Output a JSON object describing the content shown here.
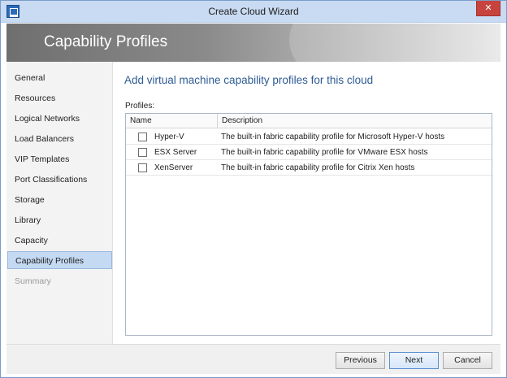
{
  "window": {
    "title": "Create Cloud Wizard",
    "close_glyph": "✕",
    "icon": "wizard-app-icon"
  },
  "banner": {
    "title": "Capability Profiles"
  },
  "sidebar": {
    "items": [
      {
        "label": "General",
        "state": "normal"
      },
      {
        "label": "Resources",
        "state": "normal"
      },
      {
        "label": "Logical Networks",
        "state": "normal"
      },
      {
        "label": "Load Balancers",
        "state": "normal"
      },
      {
        "label": "VIP Templates",
        "state": "normal"
      },
      {
        "label": "Port Classifications",
        "state": "normal"
      },
      {
        "label": "Storage",
        "state": "normal"
      },
      {
        "label": "Library",
        "state": "normal"
      },
      {
        "label": "Capacity",
        "state": "normal"
      },
      {
        "label": "Capability Profiles",
        "state": "selected"
      },
      {
        "label": "Summary",
        "state": "disabled"
      }
    ]
  },
  "main": {
    "heading": "Add virtual machine capability profiles for this cloud",
    "profiles_label": "Profiles:",
    "columns": [
      "Name",
      "Description"
    ],
    "rows": [
      {
        "name": "Hyper-V",
        "description": "The built-in fabric capability profile for Microsoft Hyper-V hosts",
        "checked": false
      },
      {
        "name": "ESX Server",
        "description": "The built-in fabric capability profile for VMware ESX hosts",
        "checked": false
      },
      {
        "name": "XenServer",
        "description": "The built-in fabric capability profile for Citrix Xen hosts",
        "checked": false
      }
    ]
  },
  "footer": {
    "previous_label": "Previous",
    "next_label": "Next",
    "cancel_label": "Cancel"
  },
  "colors": {
    "accent": "#2e5b94",
    "selected_nav": "#c4d9f2",
    "close_button": "#c7443e",
    "titlebar": "#c9dbf2"
  }
}
